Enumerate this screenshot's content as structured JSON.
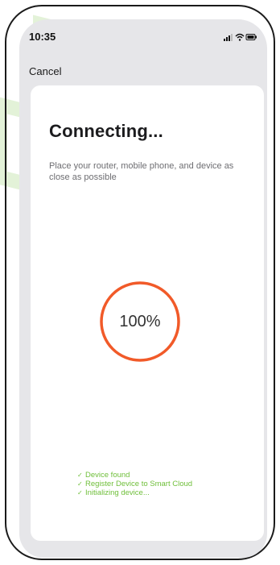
{
  "status_bar": {
    "time": "10:35"
  },
  "nav": {
    "cancel_label": "Cancel"
  },
  "card": {
    "title": "Connecting...",
    "subtitle": "Place your router, mobile phone, and device as close as possible"
  },
  "progress": {
    "percent": 100,
    "label": "100%",
    "ring_color": "#f15a29"
  },
  "steps": [
    {
      "label": "Device found",
      "status": "done"
    },
    {
      "label": "Register Device to Smart Cloud",
      "status": "done"
    },
    {
      "label": "Initializing device...",
      "status": "done"
    }
  ],
  "colors": {
    "accent": "#f15a29",
    "success": "#6fbf3a",
    "screen_bg": "#e6e6e9",
    "card_bg": "#ffffff",
    "watermark": "#e6f4dc"
  },
  "icons": {
    "check": "check-icon",
    "signal": "signal-icon",
    "wifi": "wifi-icon",
    "battery": "battery-icon"
  }
}
